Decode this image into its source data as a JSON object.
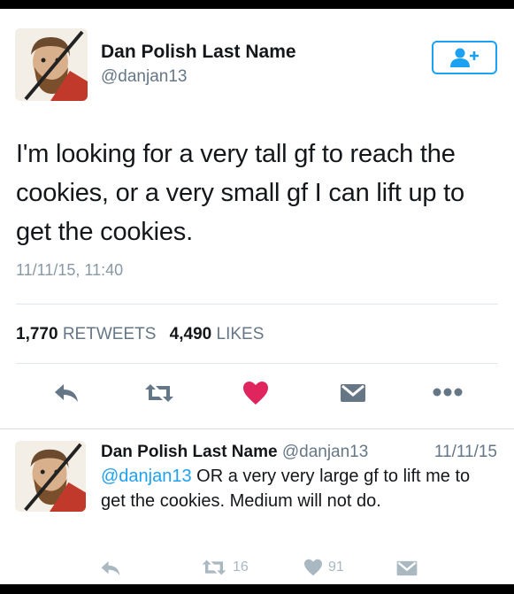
{
  "tweet": {
    "author_name": "Dan Polish Last Name",
    "author_handle": "@danjan13",
    "text": "I'm looking for a very tall gf to reach the cookies, or a very small gf I can lift up to get the cookies.",
    "timestamp": "11/11/15, 11:40",
    "retweet_count": "1,770",
    "retweet_label": "RETWEETS",
    "like_count": "4,490",
    "like_label": "LIKES",
    "liked": true,
    "actions": [
      "reply-icon",
      "retweet-icon",
      "heart-icon",
      "direct-message-icon",
      "more-icon"
    ],
    "follow_icon": "add-user-icon"
  },
  "reply": {
    "author_name": "Dan Polish Last Name",
    "author_handle": "@danjan13",
    "date": "11/11/15",
    "mention": "@danjan13",
    "text": " OR a very very large gf to lift me to get the cookies. Medium will not do.",
    "retweet_count": "16",
    "like_count": "91"
  },
  "colors": {
    "accent": "#1da1f2",
    "like": "#e0245e",
    "muted": "#657786",
    "icon_gray": "#aab8c2"
  }
}
